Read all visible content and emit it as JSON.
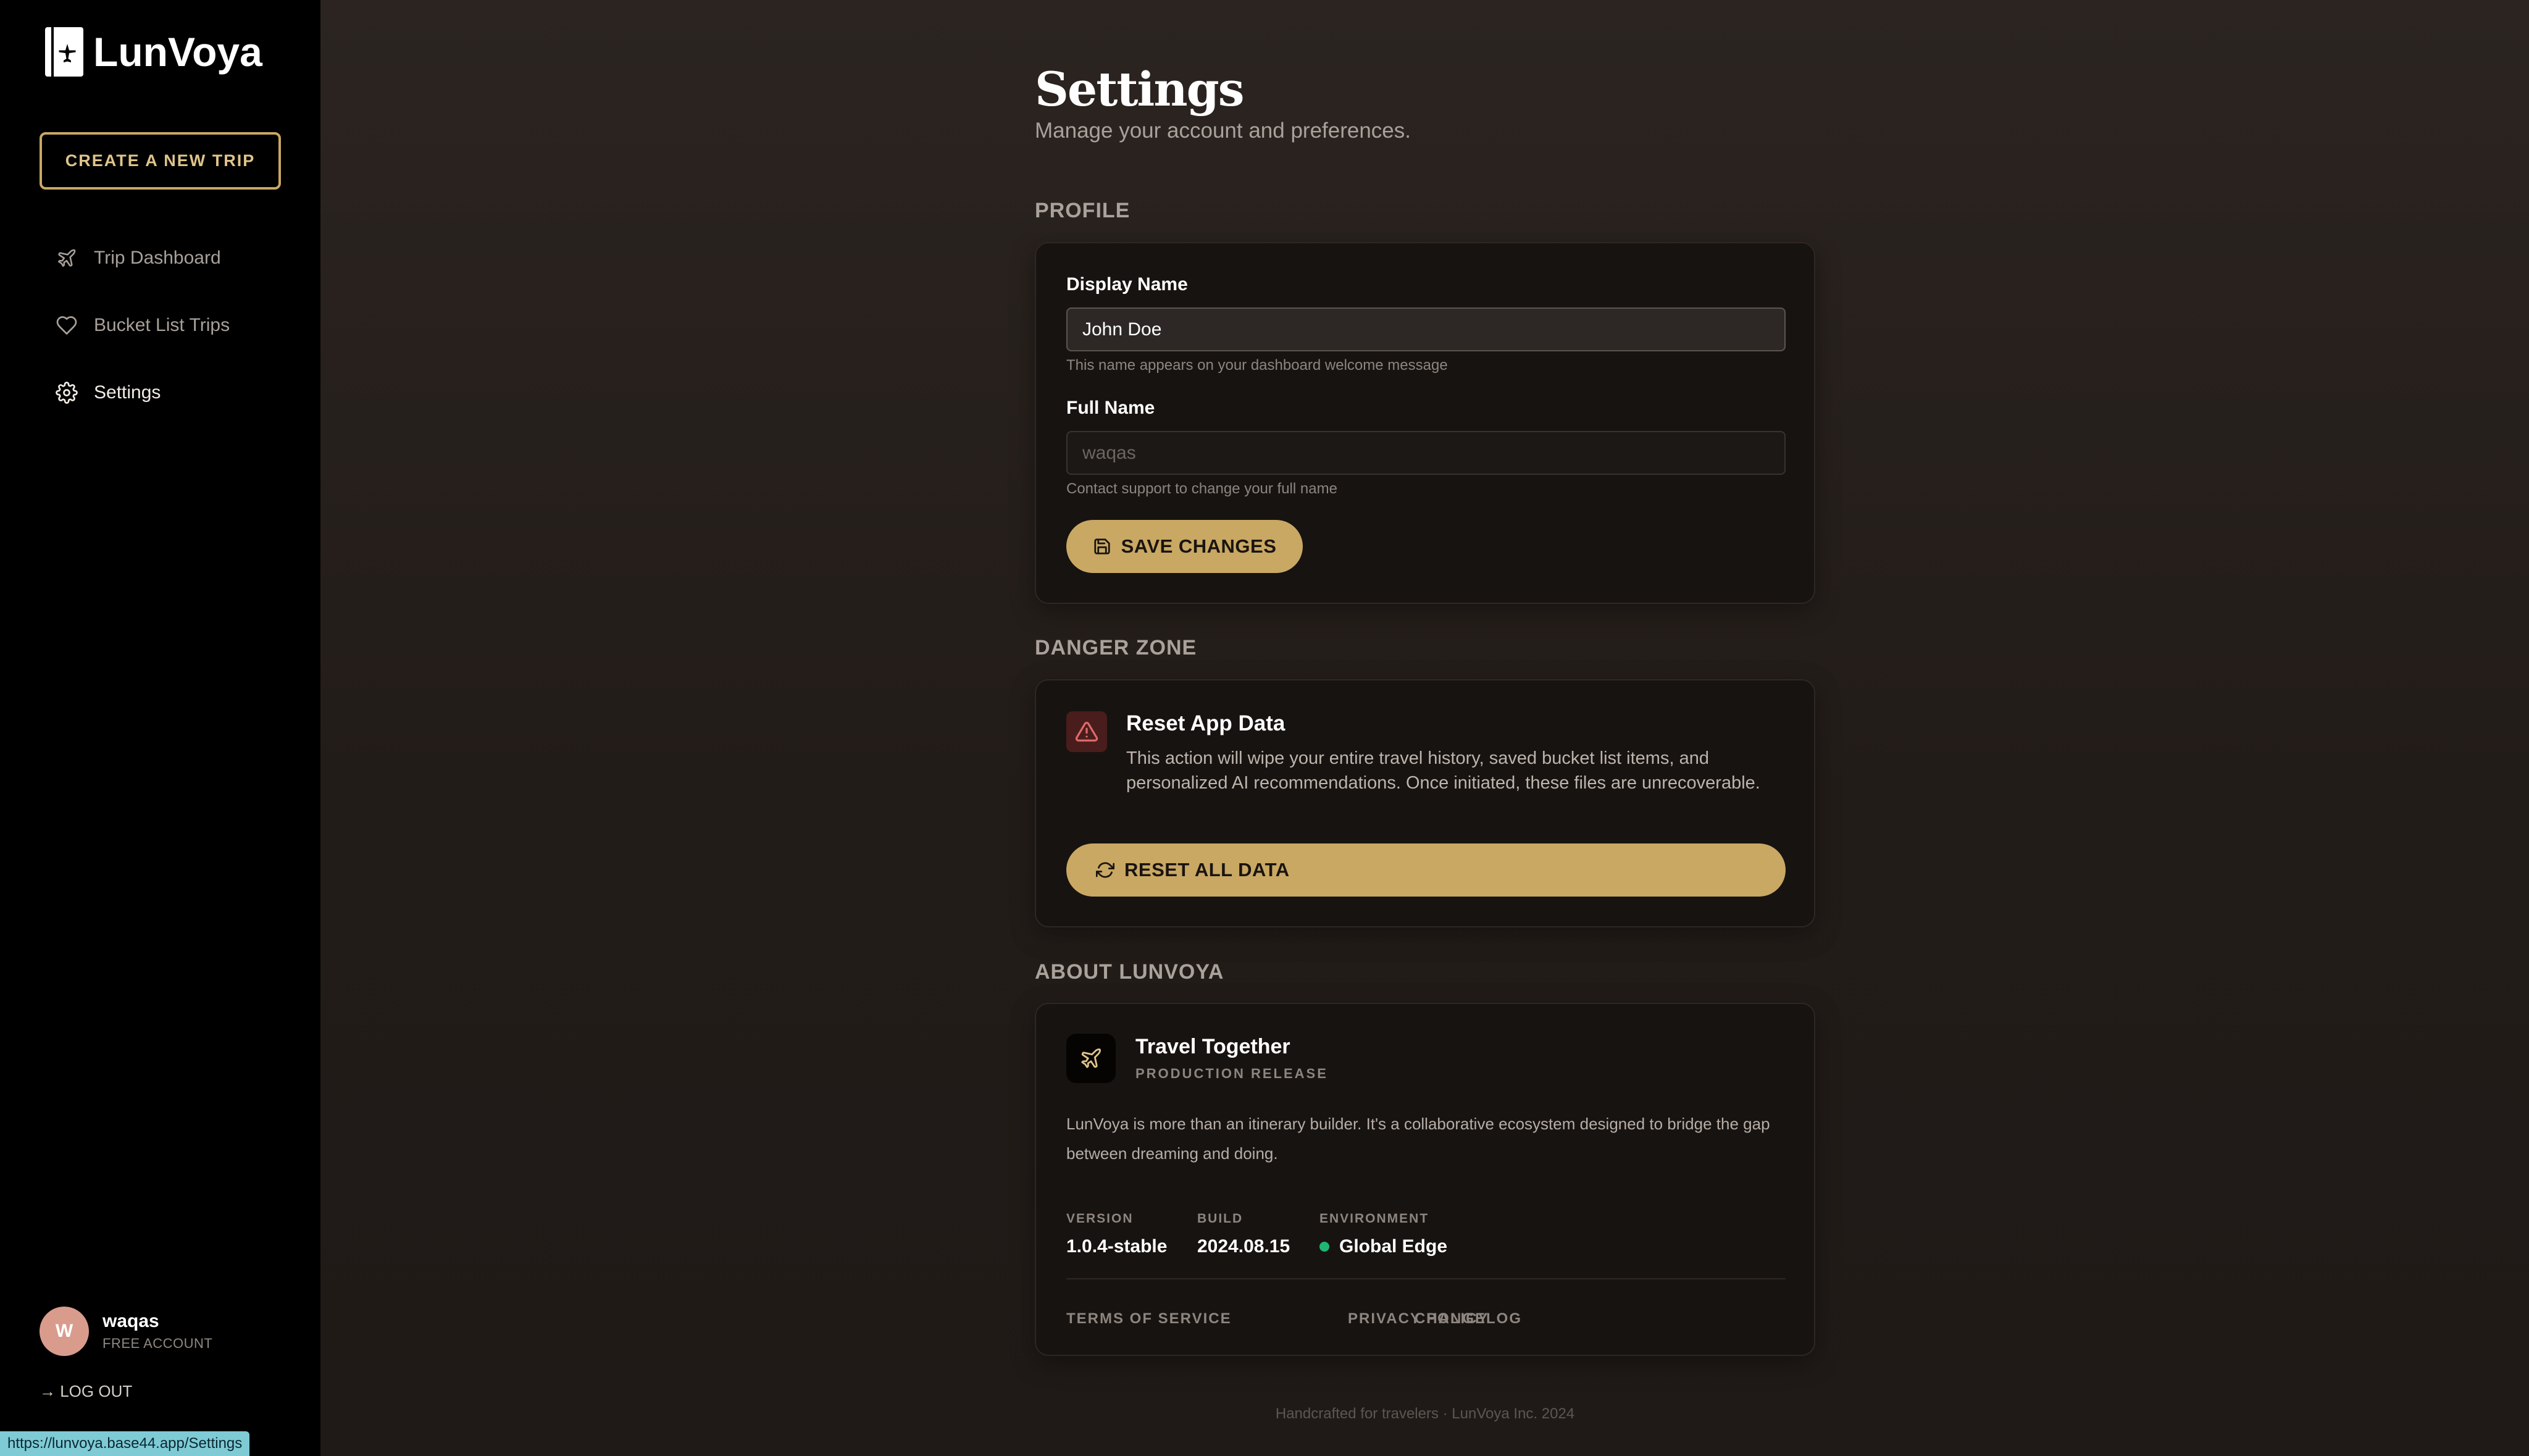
{
  "app": {
    "name": "LunVoya"
  },
  "sidebar": {
    "create_button": "CREATE A NEW TRIP",
    "items": [
      {
        "label": "Trip Dashboard",
        "icon": "plane-icon"
      },
      {
        "label": "Bucket List Trips",
        "icon": "heart-icon"
      },
      {
        "label": "Settings",
        "icon": "gear-icon",
        "active": true
      }
    ],
    "user": {
      "initial": "W",
      "name": "waqas",
      "plan": "FREE ACCOUNT"
    },
    "logout": "→ LOG OUT"
  },
  "status_url": "https://lunvoya.base44.app/Settings",
  "page": {
    "title": "Settings",
    "subtitle": "Manage your account and preferences."
  },
  "profile": {
    "heading": "PROFILE",
    "display_name_label": "Display Name",
    "display_name_value": "John Doe",
    "display_name_hint": "This name appears on your dashboard welcome message",
    "full_name_label": "Full Name",
    "full_name_value": "waqas",
    "full_name_hint": "Contact support to change your full name",
    "save_button": "SAVE CHANGES"
  },
  "danger": {
    "heading": "DANGER ZONE",
    "title": "Reset App Data",
    "text": "This action will wipe your entire travel history, saved bucket list items, and personalized AI recommendations. Once initiated, these files are unrecoverable.",
    "button": "RESET ALL DATA"
  },
  "about": {
    "heading": "ABOUT LUNVOYA",
    "title": "Travel Together",
    "subtitle": "PRODUCTION RELEASE",
    "description": "LunVoya is more than an itinerary builder. It's a collaborative ecosystem designed to bridge the gap between dreaming and doing.",
    "version_label": "VERSION",
    "version_value": "1.0.4-stable",
    "build_label": "BUILD",
    "build_value": "2024.08.15",
    "env_label": "ENVIRONMENT",
    "env_value": "Global Edge",
    "links": [
      "TERMS OF SERVICE",
      "PRIVACY POLICY",
      "CHANGELOG"
    ]
  },
  "footer": "Handcrafted for travelers · LunVoya Inc. 2024",
  "colors": {
    "accent": "#c9a863",
    "status_ok": "#1fb672",
    "danger_bg": "#4a1d1d"
  }
}
